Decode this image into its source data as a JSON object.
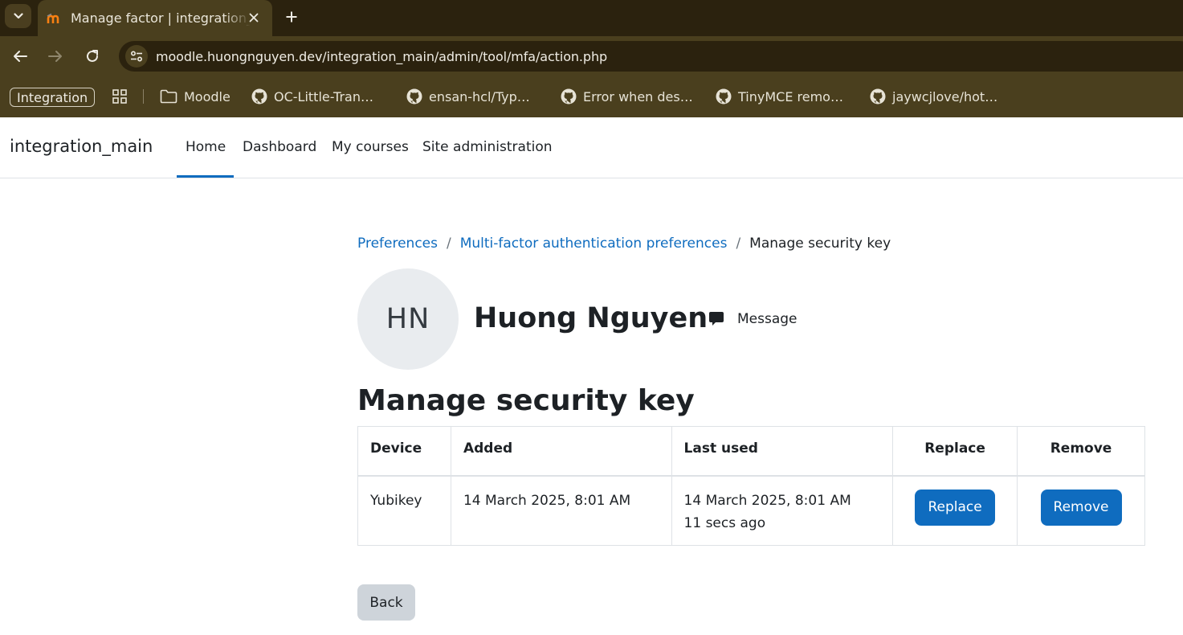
{
  "browser": {
    "tab_title": "Manage factor | integration_main",
    "url": "moodle.huongnguyen.dev/integration_main/admin/tool/mfa/action.php",
    "bookmarks": {
      "badge": "Integration",
      "items": [
        {
          "label": "Moodle",
          "icon": "folder-icon"
        },
        {
          "label": "OC-Little-Tran…",
          "icon": "github-icon"
        },
        {
          "label": "ensan-hcl/Typ…",
          "icon": "github-icon"
        },
        {
          "label": "Error when des…",
          "icon": "github-icon"
        },
        {
          "label": "TinyMCE remo…",
          "icon": "github-icon"
        },
        {
          "label": "jaywcjlove/hot…",
          "icon": "github-icon"
        }
      ]
    }
  },
  "navbar": {
    "brand": "integration_main",
    "links": [
      "Home",
      "Dashboard",
      "My courses",
      "Site administration"
    ],
    "active": "Home"
  },
  "breadcrumb": {
    "items": [
      "Preferences",
      "Multi-factor authentication preferences"
    ],
    "current": "Manage security key"
  },
  "profile": {
    "initials": "HN",
    "name": "Huong Nguyen",
    "message_label": "Message"
  },
  "page": {
    "title": "Manage security key"
  },
  "table": {
    "headers": [
      "Device",
      "Added",
      "Last used",
      "Replace",
      "Remove"
    ],
    "rows": [
      {
        "device": "Yubikey",
        "added": "14 March 2025, 8:01 AM",
        "last_used": "14 March 2025, 8:01 AM",
        "last_used_relative": "11 secs ago",
        "replace_label": "Replace",
        "remove_label": "Remove"
      }
    ]
  },
  "back_label": "Back",
  "colors": {
    "primary": "#0f6cbf",
    "secondary_button": "#ced4da",
    "browser_frame": "#4a3f1e"
  }
}
